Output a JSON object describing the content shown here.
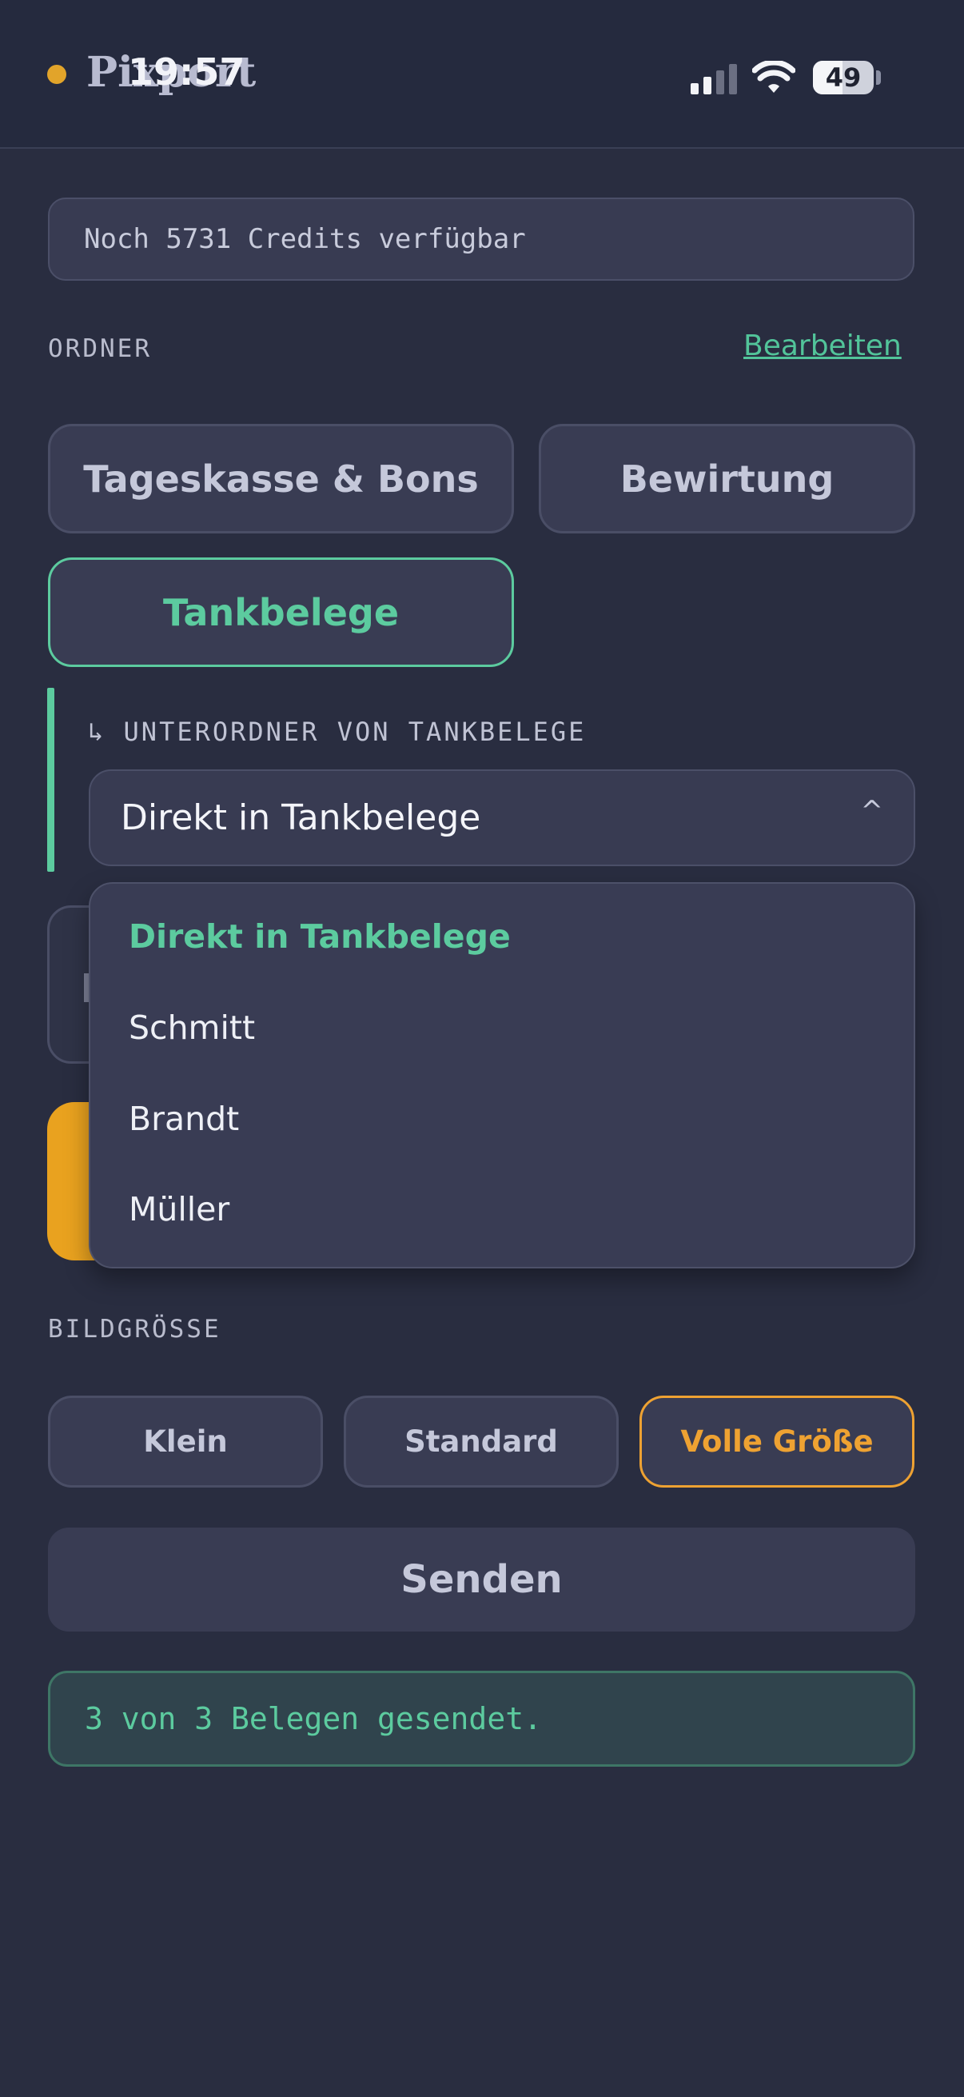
{
  "status_bar": {
    "time": "19:57",
    "battery": "49",
    "battery_level": 0.49,
    "signal_bars": 2
  },
  "app": {
    "title": "Pixport"
  },
  "credits": {
    "text": "Noch 5731 Credits verfügbar"
  },
  "folders": {
    "label": "ORDNER",
    "edit_label": "Bearbeiten",
    "items": [
      {
        "label": "Tageskasse & Bons",
        "active": false
      },
      {
        "label": "Bewirtung",
        "active": false
      },
      {
        "label": "Tankbelege",
        "active": true
      }
    ]
  },
  "subfolder": {
    "label": "↳ UNTERORDNER VON TANKBELEGE",
    "selected": "Direkt in Tankbelege",
    "caret": "^",
    "options": [
      "Direkt in Tankbelege",
      "Schmitt",
      "Brandt",
      "Müller"
    ]
  },
  "image_size": {
    "label": "BILDGRÖSSE",
    "options": [
      {
        "label": "Klein",
        "active": false
      },
      {
        "label": "Standard",
        "active": false
      },
      {
        "label": "Volle Größe",
        "active": true
      }
    ]
  },
  "send": {
    "label": "Senden"
  },
  "result": {
    "text": "3 von 3 Belegen gesendet."
  },
  "colors": {
    "background": "#292d40",
    "accent_green": "#5ccb9f",
    "accent_orange": "#eea232"
  }
}
